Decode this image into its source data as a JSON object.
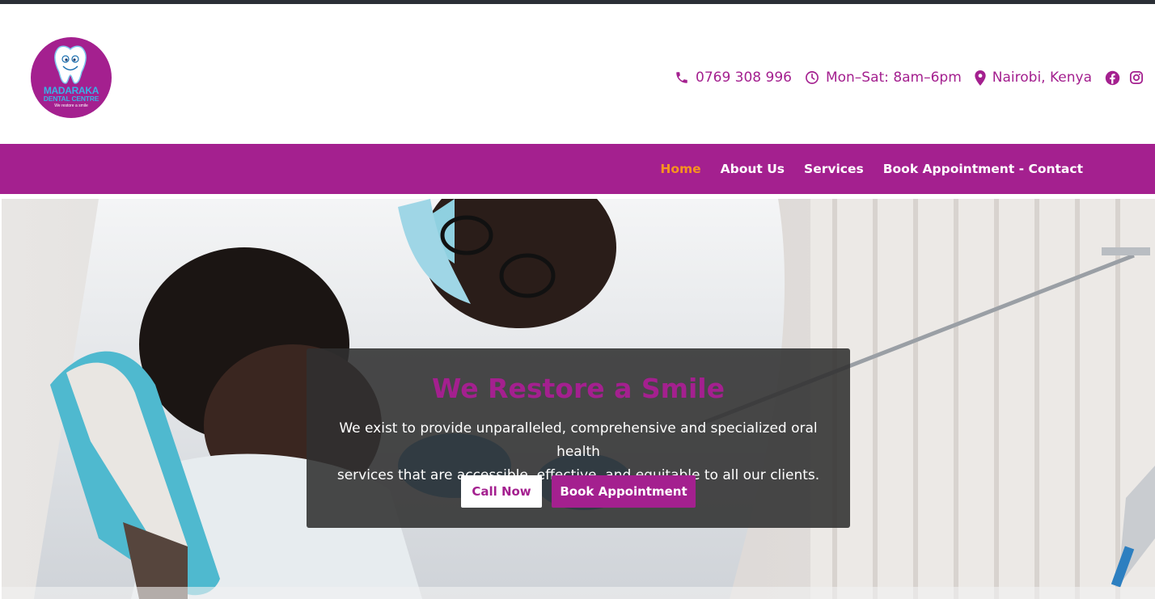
{
  "brand": {
    "logo_line1": "MADARAKA",
    "logo_line2": "DENTAL CENTRE",
    "logo_line3": "We restore a smile",
    "primary_color": "#a4208f",
    "accent_color": "#f7931e"
  },
  "contact": {
    "phone": "0769 308 996",
    "hours": "Mon–Sat: 8am–6pm",
    "location": "Nairobi, Kenya",
    "phone_icon": "phone-icon",
    "hours_icon": "clock-icon",
    "location_icon": "map-pin-icon",
    "social_icons": [
      "facebook-icon",
      "instagram-icon"
    ]
  },
  "nav": {
    "items": [
      {
        "label": "Home",
        "active": true
      },
      {
        "label": "About Us",
        "active": false
      },
      {
        "label": "Services",
        "active": false
      },
      {
        "label": "Book Appointment - Contact",
        "active": false
      }
    ]
  },
  "hero": {
    "title": "We Restore a Smile",
    "subtitle_line1": "We exist to provide unparalleled, comprehensive and specialized oral health",
    "subtitle_line2": "services that are accessible, effective, and equitable to all our clients.",
    "call_button": "Call Now",
    "book_button": "Book Appointment"
  }
}
